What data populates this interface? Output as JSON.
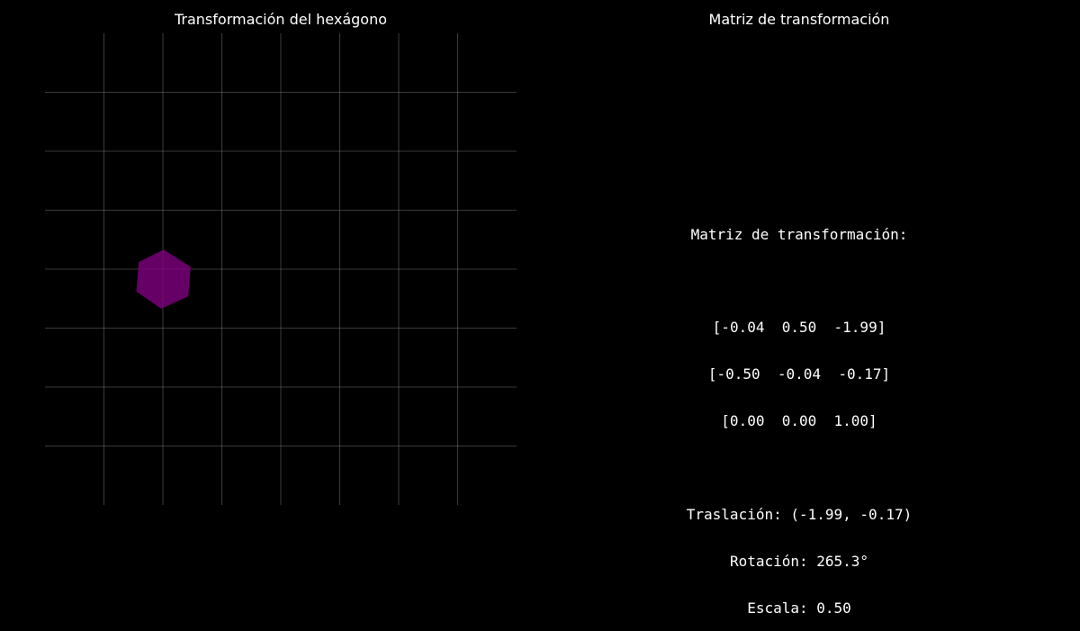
{
  "left_panel": {
    "title": "Transformación del hexágono"
  },
  "right_panel": {
    "title": "Matriz de transformación"
  },
  "matrix_text": {
    "heading": "Matriz de transformación:",
    "rows": [
      "[-0.04  0.50  -1.99]",
      "[-0.50  -0.04  -0.17]",
      "[0.00  0.00  1.00]"
    ],
    "translation": "Traslación: (-1.99, -0.17)",
    "rotation": "Rotación: 265.3°",
    "scale": "Escala: 0.50"
  },
  "chart_data": {
    "type": "scatter",
    "title": "Transformación del hexágono",
    "xlim": [
      -4,
      4
    ],
    "ylim": [
      -4,
      4
    ],
    "grid": true,
    "axes_visible": false,
    "shape": {
      "kind": "polygon",
      "name": "hexagon",
      "fill": "#800080",
      "alpha": 0.8,
      "vertices": [
        [
          -1.99,
          0.33
        ],
        [
          -1.53,
          0.04
        ],
        [
          -1.57,
          -0.46
        ],
        [
          -2.03,
          -0.67
        ],
        [
          -2.45,
          -0.38
        ],
        [
          -2.41,
          0.12
        ]
      ]
    }
  },
  "colors": {
    "background": "#000000",
    "text": "#ffffff",
    "grid": "#808080",
    "hexagon": "#800080"
  }
}
